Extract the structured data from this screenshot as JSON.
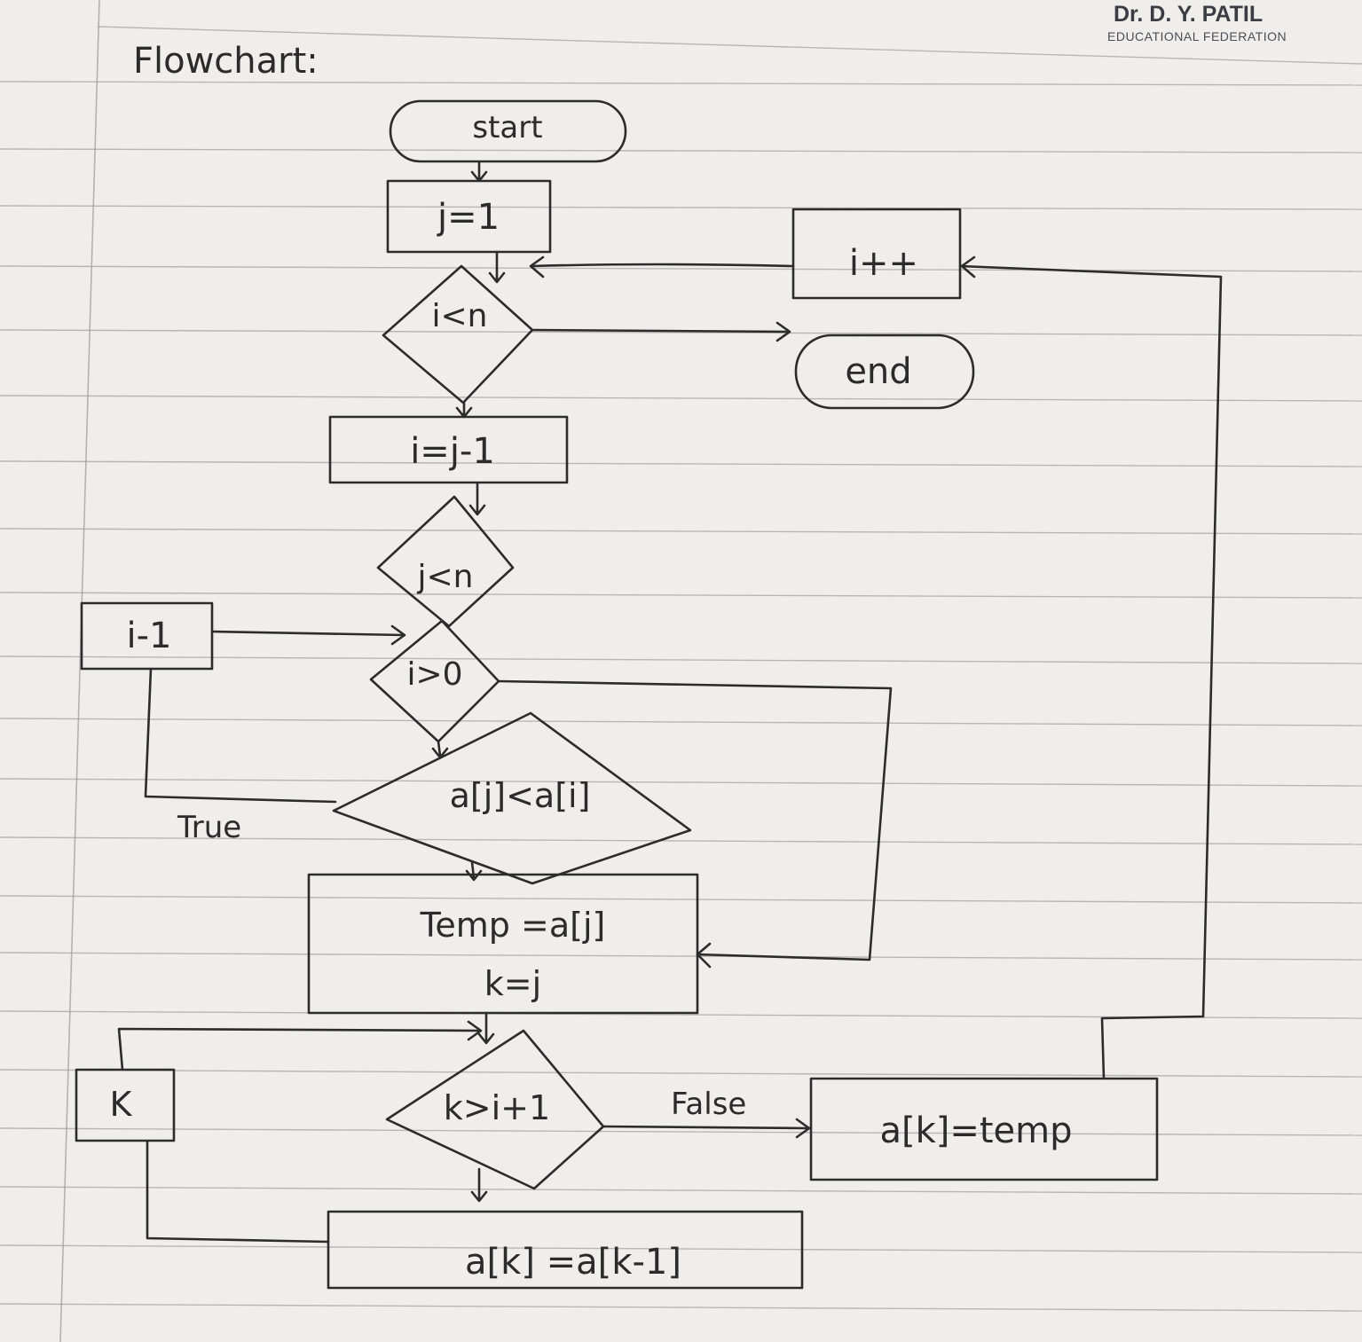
{
  "header": {
    "brand_name": "Dr. D. Y. PATIL",
    "brand_tagline": "EDUCATIONAL FEDERATION",
    "page_heading": "Flowchart:"
  },
  "flowchart": {
    "nodes": {
      "start": "start",
      "init_j": "j=1",
      "cond_outer": "i<n",
      "end": "end",
      "incr_i": "i++",
      "assign_i": "i=j-1",
      "cond_j": "j<n",
      "cond_i_pos": "i>0",
      "decrement_i": "i-1",
      "cond_compare": "a[j]<a[i]",
      "temp_line1": "Temp =a[j]",
      "temp_line2": "k=j",
      "cond_k": "k>i+1",
      "k_box": "K",
      "assign_ak_temp": "a[k]=temp",
      "shift": "a[k] =a[k-1]"
    },
    "edge_labels": {
      "true_label": "True",
      "false_label": "False"
    }
  }
}
